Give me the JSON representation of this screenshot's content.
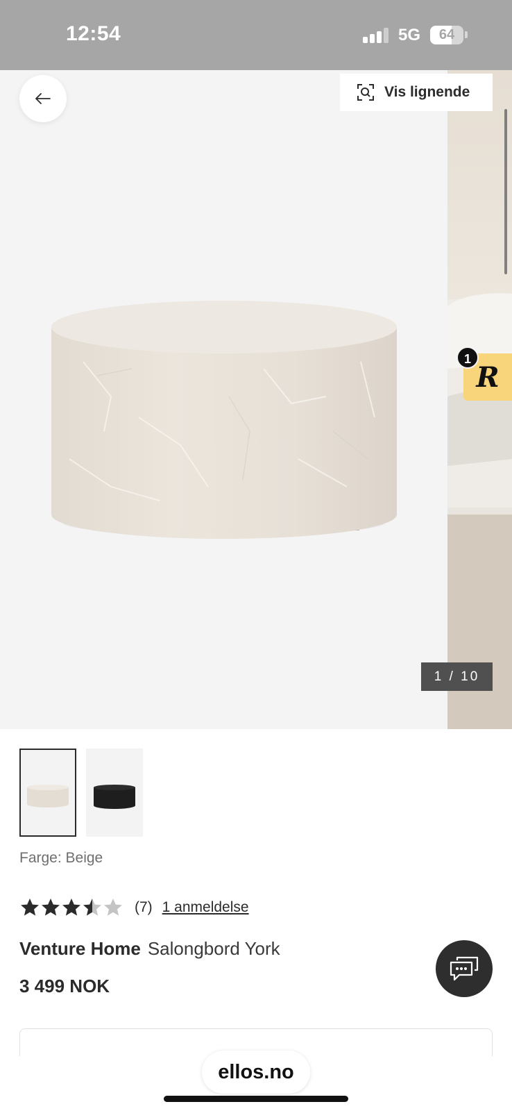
{
  "status_bar": {
    "time": "12:54",
    "network": "5G",
    "battery_percent": "64"
  },
  "gallery": {
    "similar_button_label": "Vis lignende",
    "counter": "1 / 10",
    "rewards_badge_letter": "R",
    "rewards_badge_count": "1",
    "icons": {
      "back": "arrow-left-icon",
      "similar": "visual-search-icon"
    }
  },
  "product": {
    "color_line": "Farge: Beige",
    "rating": {
      "stars": 3.5,
      "max": 5,
      "count": "(7)",
      "reviews_link": "1 anmeldelse"
    },
    "brand": "Venture Home",
    "name": "Salongbord York",
    "price": "3 499 NOK",
    "thumbnails": [
      {
        "color": "#e4ddd4",
        "label": "beige"
      },
      {
        "color": "#1e1e1e",
        "label": "black"
      }
    ]
  },
  "browser": {
    "url": "ellos.no"
  },
  "colors": {
    "text": "#2b2b2b",
    "counter_bg": "#505050",
    "rewards_bg": "#f8d47a",
    "chat_bg": "#2e2e2e"
  }
}
